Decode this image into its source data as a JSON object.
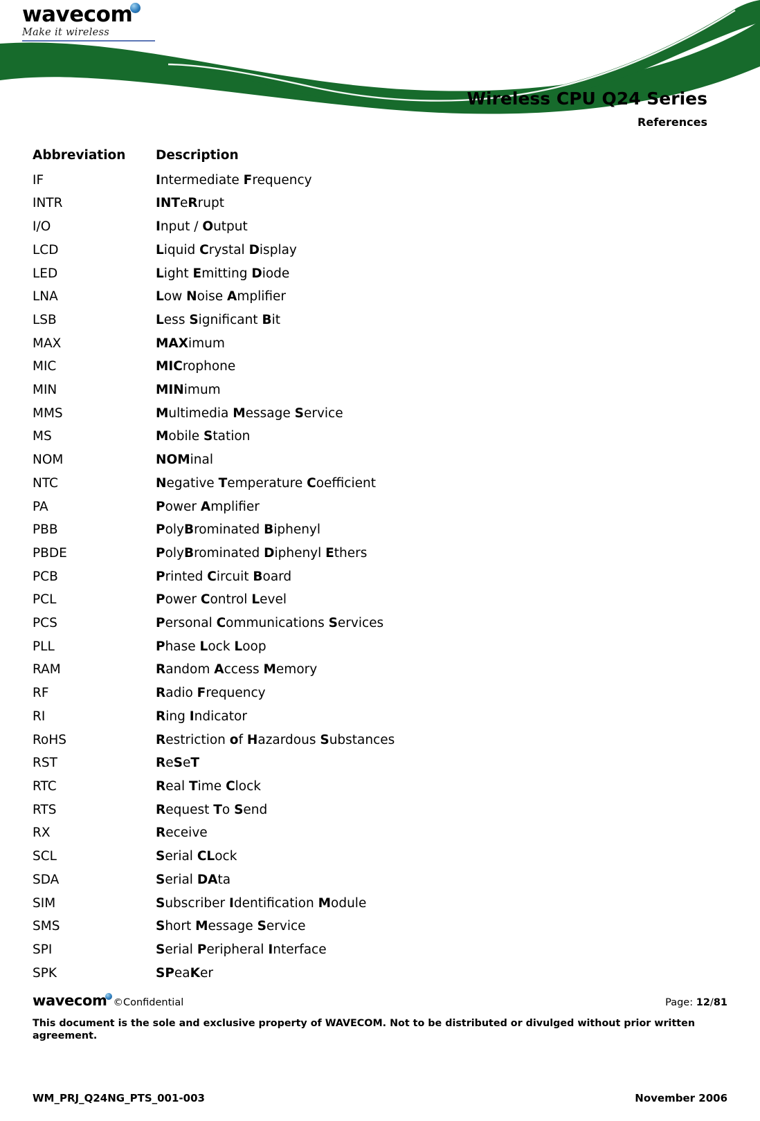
{
  "brand": {
    "logo_text": "wavecom",
    "tagline": "Make it wireless",
    "footer_logo_text": "wavecom",
    "green": "#176B2C",
    "rule_blue": "#5B76B5"
  },
  "header": {
    "title": "Wireless CPU Q24 Series",
    "subtitle": "References"
  },
  "table": {
    "headers": {
      "abbreviation": "Abbreviation",
      "description": "Description"
    },
    "rows": [
      {
        "abbr": "IF",
        "desc_html": "<b>I</b>ntermediate <b>F</b>requency"
      },
      {
        "abbr": "INTR",
        "desc_html": "<b>INT</b>e<b>R</b>rupt"
      },
      {
        "abbr": "I/O",
        "desc_html": "<b>I</b>nput / <b>O</b>utput"
      },
      {
        "abbr": "LCD",
        "desc_html": "<b>L</b>iquid <b>C</b>rystal <b>D</b>isplay"
      },
      {
        "abbr": "LED",
        "desc_html": "<b>L</b>ight <b>E</b>mitting <b>D</b>iode"
      },
      {
        "abbr": "LNA",
        "desc_html": "<b>L</b>ow <b>N</b>oise <b>A</b>mplifier"
      },
      {
        "abbr": "LSB",
        "desc_html": "<b>L</b>ess <b>S</b>ignificant <b>B</b>it"
      },
      {
        "abbr": "MAX",
        "desc_html": "<b>MAX</b>imum"
      },
      {
        "abbr": "MIC",
        "desc_html": "<b>MIC</b>rophone"
      },
      {
        "abbr": "MIN",
        "desc_html": "<b>MIN</b>imum"
      },
      {
        "abbr": "MMS",
        "desc_html": "<b>M</b>ultimedia <b>M</b>essage <b>S</b>ervice"
      },
      {
        "abbr": "MS",
        "desc_html": "<b>M</b>obile <b>S</b>tation"
      },
      {
        "abbr": "NOM",
        "desc_html": "<b>NOM</b>inal"
      },
      {
        "abbr": "NTC",
        "desc_html": "<b>N</b>egative <b>T</b>emperature <b>C</b>oefficient"
      },
      {
        "abbr": "PA",
        "desc_html": "<b>P</b>ower <b>A</b>mplifier"
      },
      {
        "abbr": "PBB",
        "desc_html": "<b>P</b>oly<b>B</b>rominated <b>B</b>iphenyl"
      },
      {
        "abbr": "PBDE",
        "desc_html": "<b>P</b>oly<b>B</b>rominated <b>D</b>iphenyl <b>E</b>thers"
      },
      {
        "abbr": "PCB",
        "desc_html": "<b>P</b>rinted <b>C</b>ircuit <b>B</b>oard"
      },
      {
        "abbr": "PCL",
        "desc_html": "<b>P</b>ower <b>C</b>ontrol <b>L</b>evel"
      },
      {
        "abbr": "PCS",
        "desc_html": "<b>P</b>ersonal <b>C</b>ommunications <b>S</b>ervices"
      },
      {
        "abbr": "PLL",
        "desc_html": "<b>P</b>hase <b>L</b>ock <b>L</b>oop"
      },
      {
        "abbr": "RAM",
        "desc_html": "<b>R</b>andom <b>A</b>ccess <b>M</b>emory"
      },
      {
        "abbr": "RF",
        "desc_html": "<b>R</b>adio <b>F</b>requency"
      },
      {
        "abbr": "RI",
        "desc_html": "<b>R</b>ing <b>I</b>ndicator"
      },
      {
        "abbr": "RoHS",
        "desc_html": "<b>R</b>estriction <b>o</b>f <b>H</b>azardous <b>S</b>ubstances"
      },
      {
        "abbr": "RST",
        "desc_html": "<b>R</b>e<b>S</b>e<b>T</b>"
      },
      {
        "abbr": "RTC",
        "desc_html": "<b>R</b>eal <b>T</b>ime <b>C</b>lock"
      },
      {
        "abbr": "RTS",
        "desc_html": "<b>R</b>equest <b>T</b>o <b>S</b>end"
      },
      {
        "abbr": "RX",
        "desc_html": "<b>R</b>eceive"
      },
      {
        "abbr": "SCL",
        "desc_html": "<b>S</b>erial <b>CL</b>ock"
      },
      {
        "abbr": "SDA",
        "desc_html": "<b>S</b>erial <b>DA</b>ta"
      },
      {
        "abbr": "SIM",
        "desc_html": "<b>S</b>ubscriber <b>I</b>dentification <b>M</b>odule"
      },
      {
        "abbr": "SMS",
        "desc_html": "<b>S</b>hort <b>M</b>essage <b>S</b>ervice"
      },
      {
        "abbr": "SPI",
        "desc_html": "<b>S</b>erial <b>P</b>eripheral <b>I</b>nterface"
      },
      {
        "abbr": "SPK",
        "desc_html": "<b>SP</b>ea<b>K</b>er"
      }
    ]
  },
  "footer": {
    "confidential": "©Confidential",
    "page_label": "Page:",
    "page_current": "12",
    "page_separator": "/",
    "page_total": "81",
    "disclaimer": "This document is the sole and exclusive property of WAVECOM. Not to be distributed or divulged without prior written agreement.",
    "doc_ref": "WM_PRJ_Q24NG_PTS_001-003",
    "doc_date": "November 2006"
  }
}
